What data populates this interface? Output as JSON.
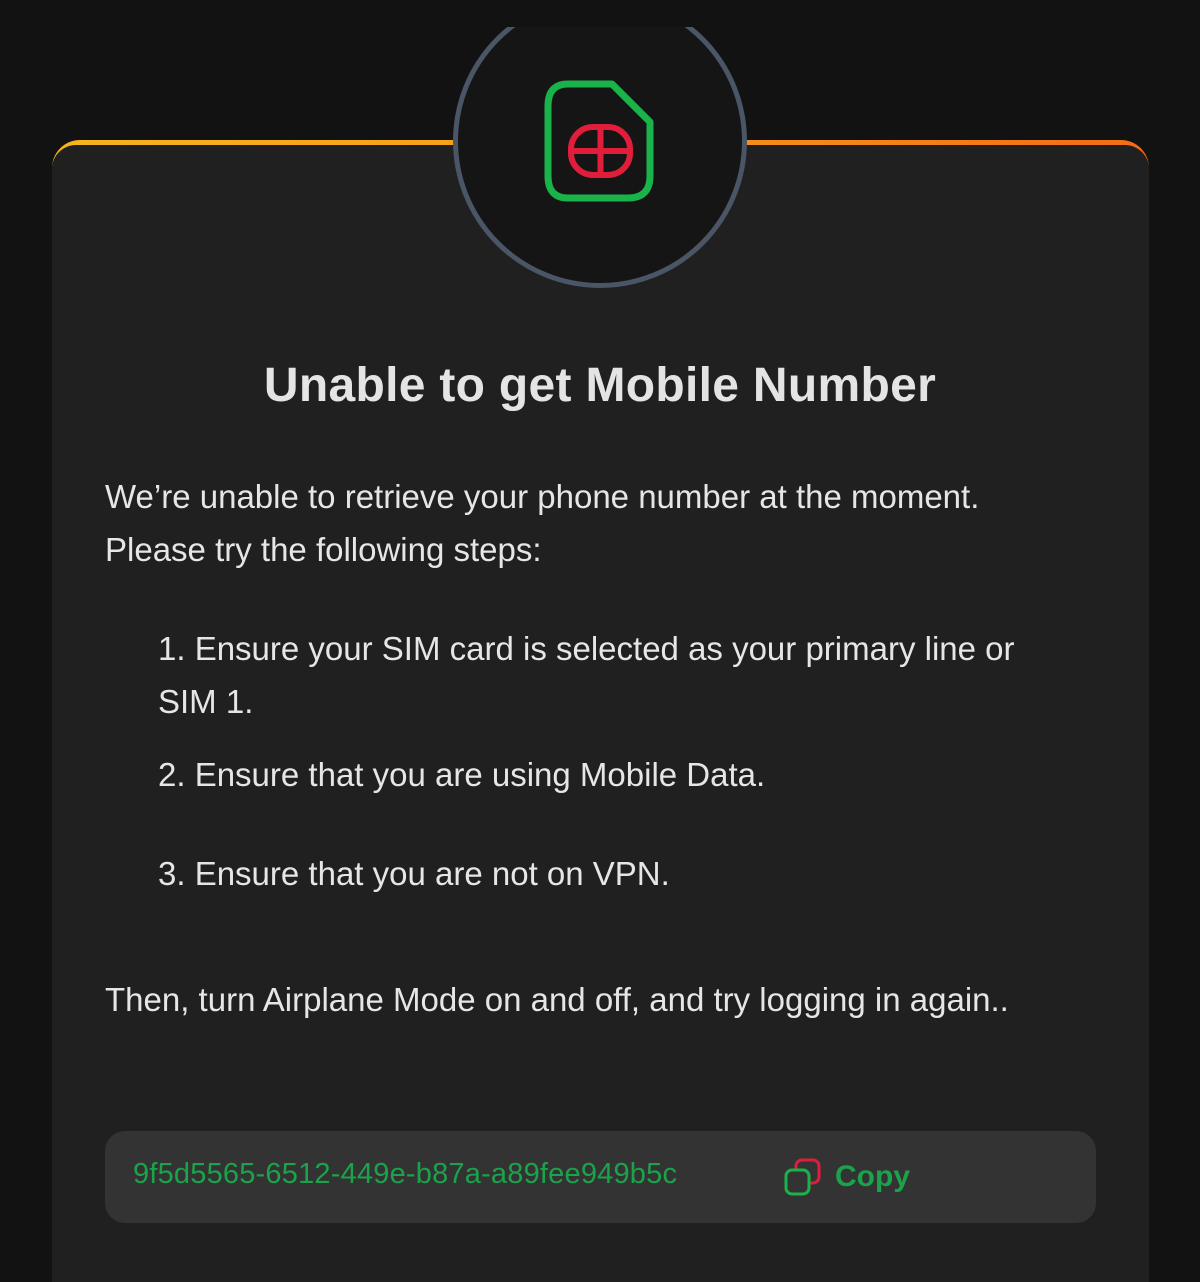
{
  "dialog": {
    "title": "Unable to get Mobile Number",
    "intro": "We’re unable to retrieve your phone number at the moment. Please try the following steps:",
    "steps": [
      "1. Ensure your SIM card is selected as your primary line or SIM 1.",
      "2. Ensure that you are using Mobile Data.",
      "3. Ensure that you are not on VPN."
    ],
    "outro": "Then, turn Airplane Mode on and off, and try logging in again..",
    "reference_id": "9f5d5565-6512-449e-b87a-a89fee949b5c",
    "copy_label": "Copy"
  },
  "icons": {
    "badge": "sim-card-icon",
    "copy": "copy-icon"
  },
  "colors": {
    "background": "#121212",
    "card": "#202020",
    "accent_start": "#f6b41b",
    "accent_end": "#f36b16",
    "ring": "#4a5566",
    "sim_outline": "#19b34a",
    "sim_chip": "#e01e3c",
    "id_green": "#1aa34a",
    "id_box": "#333333"
  }
}
